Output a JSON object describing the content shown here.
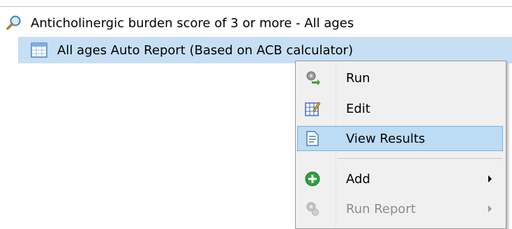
{
  "tree": {
    "parent_label": "Anticholinergic burden score of 3 or more - All ages",
    "child_label": "All ages Auto Report (Based on ACB calculator)"
  },
  "context_menu": {
    "items": [
      {
        "label": "Run",
        "icon": "run-gear-arrow-icon"
      },
      {
        "label": "Edit",
        "icon": "edit-grid-pencil-icon"
      },
      {
        "label": "View Results",
        "icon": "view-results-document-icon"
      },
      {
        "label": "Add",
        "icon": "add-plus-icon"
      },
      {
        "label": "Run Report",
        "icon": "run-report-gear-icon"
      }
    ]
  },
  "colors": {
    "selection": "#c6dff5",
    "menu_hover": "#bcdcf4",
    "add_green": "#2e9e3c",
    "disabled_text": "#8d8d8d"
  }
}
